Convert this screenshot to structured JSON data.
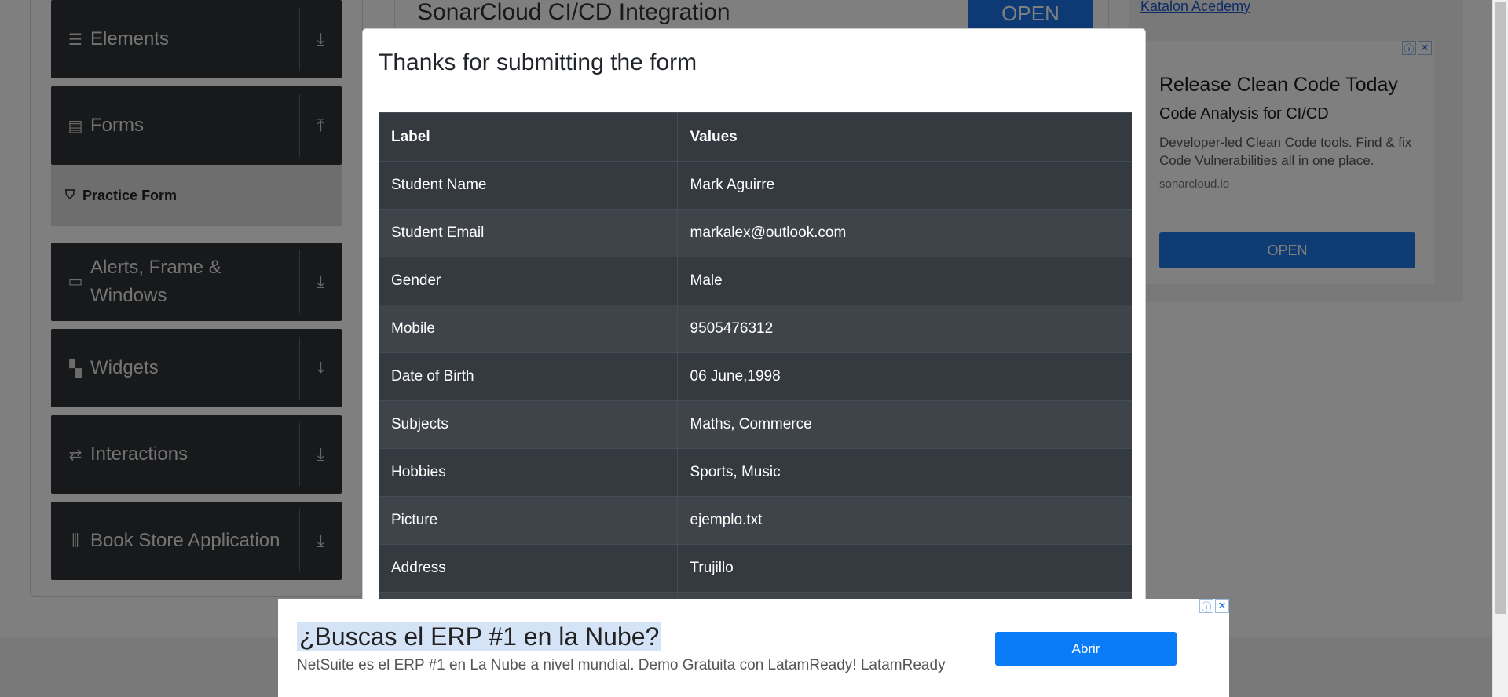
{
  "sidebar": {
    "groups": [
      {
        "label": "Elements",
        "icon": "menu-icon"
      },
      {
        "label": "Forms",
        "icon": "document-icon"
      },
      {
        "label": "Alerts, Frame & Windows",
        "icon": "window-icon"
      },
      {
        "label": "Widgets",
        "icon": "widgets-icon"
      },
      {
        "label": "Interactions",
        "icon": "interactions-icon"
      },
      {
        "label": "Book Store Application",
        "icon": "books-icon"
      }
    ],
    "active_item": "Practice Form"
  },
  "background_ad_top": {
    "title": "SonarCloud CI/CD Integration",
    "button": "OPEN"
  },
  "right_ad": {
    "broken_image_alt": "Katalon Acedemy",
    "headline": "Release Clean Code Today",
    "subheadline": "Code Analysis for CI/CD",
    "description": "Developer-led Clean Code tools. Find & fix Code Vulnerabilities all in one place.",
    "url": "sonarcloud.io",
    "button": "OPEN"
  },
  "modal": {
    "title": "Thanks for submitting the form",
    "table": {
      "headers": [
        "Label",
        "Values"
      ],
      "rows": [
        {
          "label": "Student Name",
          "value": "Mark Aguirre"
        },
        {
          "label": "Student Email",
          "value": "markalex@outlook.com"
        },
        {
          "label": "Gender",
          "value": "Male"
        },
        {
          "label": "Mobile",
          "value": "9505476312"
        },
        {
          "label": "Date of Birth",
          "value": "06 June,1998"
        },
        {
          "label": "Subjects",
          "value": "Maths, Commerce"
        },
        {
          "label": "Hobbies",
          "value": "Sports, Music"
        },
        {
          "label": "Picture",
          "value": "ejemplo.txt"
        },
        {
          "label": "Address",
          "value": "Trujillo"
        }
      ]
    }
  },
  "bottom_ad": {
    "title": "¿Buscas el ERP #1 en la Nube?",
    "description": "NetSuite es el ERP #1 en La Nube a nivel mundial. Demo Gratuita con LatamReady! LatamReady",
    "button": "Abrir"
  },
  "colors": {
    "sidebar_bg": "#2f3337",
    "table_bg": "#343a40",
    "ad_button": "#1f78e4",
    "bottom_ad_button": "#0b7cf8"
  }
}
